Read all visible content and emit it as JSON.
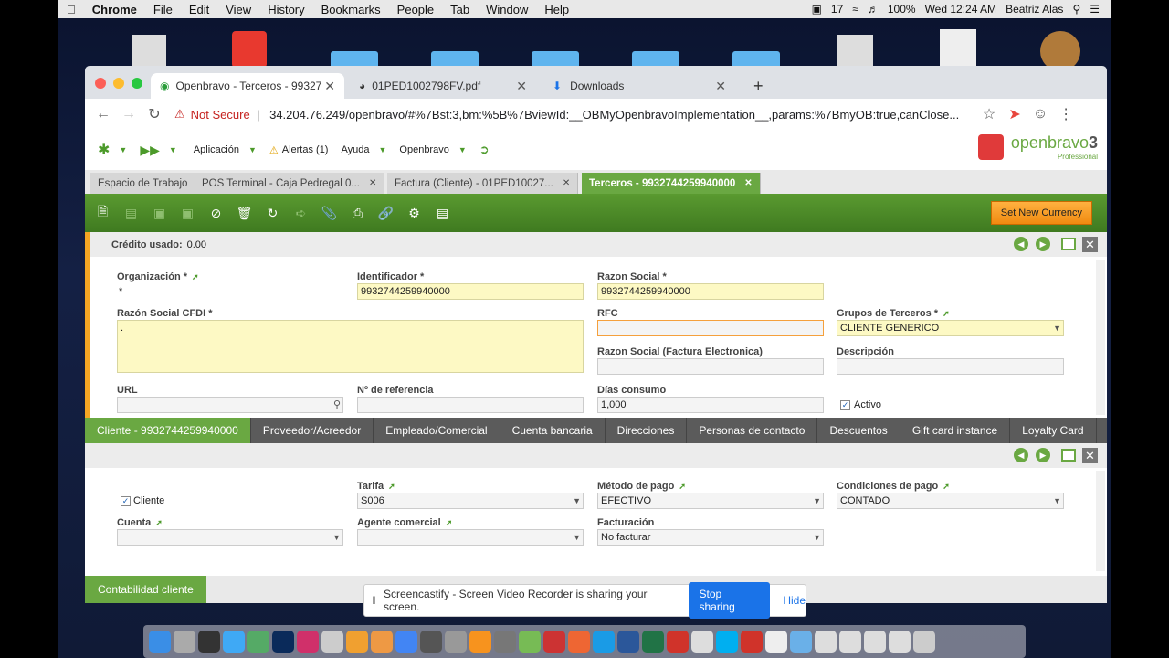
{
  "menubar": {
    "app": "Chrome",
    "items": [
      "File",
      "Edit",
      "View",
      "History",
      "Bookmarks",
      "People",
      "Tab",
      "Window",
      "Help"
    ],
    "badge_count": "17",
    "battery": "100%",
    "datetime": "Wed 12:24 AM",
    "user": "Beatriz Alas"
  },
  "browser": {
    "tabs": [
      {
        "label": "Openbravo - Terceros - 99327"
      },
      {
        "label": "01PED1002798FV.pdf"
      },
      {
        "label": "Downloads"
      }
    ],
    "not_secure": "Not Secure",
    "url": "34.204.76.249/openbravo/#%7Bst:3,bm:%5B%7BviewId:__OBMyOpenbravoImplementation__,params:%7BmyOB:true,canClose..."
  },
  "ob": {
    "menu": {
      "aplicacion": "Aplicación",
      "alertas": "Alertas (1)",
      "ayuda": "Ayuda",
      "openbravo": "Openbravo"
    },
    "logo_text": "openbravo",
    "logo_sub": "Professional",
    "logo_num": "3",
    "tabs": [
      {
        "label": "Espacio de Trabajo"
      },
      {
        "label": "POS Terminal - Caja Pedregal 0..."
      },
      {
        "label": "Factura (Cliente) - 01PED10027..."
      },
      {
        "label": "Terceros - 9932744259940000"
      }
    ],
    "set_currency": "Set New Currency",
    "credito": "Crédito usado:",
    "credito_value": "0.00",
    "fields": {
      "organizacion_label": "Organización *",
      "organizacion_value": "*",
      "identificador_label": "Identificador *",
      "identificador_value": "9932744259940000",
      "razon_social_label": "Razon Social *",
      "razon_social_value": "9932744259940000",
      "razon_cfdi_label": "Razón Social CFDI *",
      "razon_cfdi_value": ".",
      "rfc_label": "RFC",
      "rfc_value": "",
      "grupos_label": "Grupos de Terceros *",
      "grupos_value": "CLIENTE GENERICO",
      "razon_fe_label": "Razon Social (Factura Electronica)",
      "razon_fe_value": "",
      "descripcion_label": "Descripción",
      "descripcion_value": "",
      "url_label": "URL",
      "url_value": "",
      "referencia_label": "Nº de referencia",
      "referencia_value": "",
      "dias_label": "Días consumo",
      "dias_value": "1,000",
      "activo_label": "Activo"
    },
    "subtabs": [
      {
        "label": "Cliente - 9932744259940000"
      },
      {
        "label": "Proveedor/Acreedor"
      },
      {
        "label": "Empleado/Comercial"
      },
      {
        "label": "Cuenta bancaria"
      },
      {
        "label": "Direcciones"
      },
      {
        "label": "Personas de contacto"
      },
      {
        "label": "Descuentos"
      },
      {
        "label": "Gift card instance"
      },
      {
        "label": "Loyalty Card"
      }
    ],
    "fields2": {
      "cliente_label": "Cliente",
      "tarifa_label": "Tarifa",
      "tarifa_value": "S006",
      "metodo_label": "Método de pago",
      "metodo_value": "EFECTIVO",
      "condiciones_label": "Condiciones de pago",
      "condiciones_value": "CONTADO",
      "cuenta_label": "Cuenta",
      "cuenta_value": "",
      "agente_label": "Agente comercial",
      "agente_value": "",
      "facturacion_label": "Facturación",
      "facturacion_value": "No facturar"
    },
    "footer_tab": "Contabilidad cliente"
  },
  "share": {
    "text": "Screencastify - Screen Video Recorder is sharing your screen.",
    "stop": "Stop sharing",
    "hide": "Hide"
  }
}
